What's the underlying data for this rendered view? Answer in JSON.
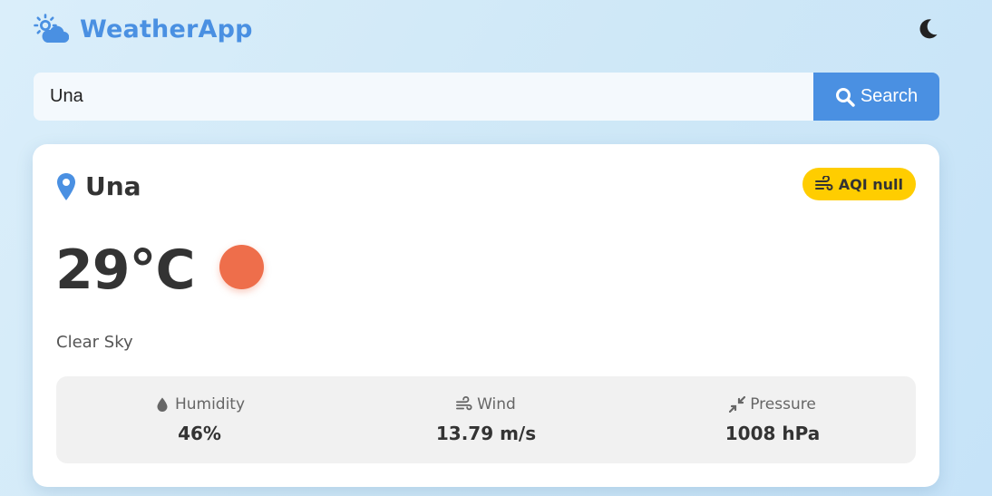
{
  "header": {
    "title": "WeatherApp",
    "brand_icon": "sun-cloud-icon",
    "theme_toggle_icon": "moon-icon"
  },
  "search": {
    "value": "Una",
    "placeholder": "",
    "button_label": "Search",
    "button_icon": "search-icon"
  },
  "current": {
    "city": "Una",
    "aqi_label": "AQI null",
    "temperature": "29°C",
    "condition": "Clear Sky",
    "condition_icon": "sun-icon"
  },
  "stats": [
    {
      "icon": "droplet-icon",
      "label": "Humidity",
      "value": "46%"
    },
    {
      "icon": "wind-icon",
      "label": "Wind",
      "value": "13.79 m/s"
    },
    {
      "icon": "compress-icon",
      "label": "Pressure",
      "value": "1008 hPa"
    }
  ],
  "colors": {
    "accent": "#4a90e2",
    "aqi_badge": "#ffcd00",
    "sun": "#ee6e4b",
    "text": "#333333"
  }
}
